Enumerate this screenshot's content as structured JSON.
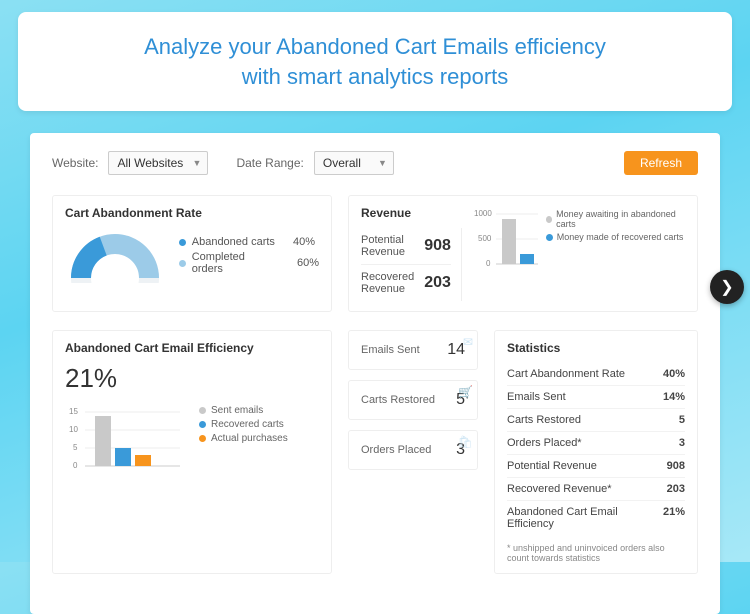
{
  "hero": {
    "title_line1": "Analyze your Abandoned Cart Emails efficiency",
    "title_line2": "with smart analytics reports"
  },
  "filters": {
    "website_label": "Website:",
    "website_value": "All Websites",
    "date_label": "Date Range:",
    "date_value": "Overall",
    "refresh_label": "Refresh"
  },
  "abandon": {
    "title": "Cart Abandonment Rate",
    "legend": [
      {
        "label": "Abandoned carts",
        "value": "40%",
        "color": "blue"
      },
      {
        "label": "Completed orders",
        "value": "60%",
        "color": "lblue"
      }
    ]
  },
  "revenue": {
    "title": "Revenue",
    "potential_label": "Potential Revenue",
    "potential_value": "908",
    "recovered_label": "Recovered Revenue",
    "recovered_value": "203",
    "legend": [
      {
        "label": "Money awaiting in abandoned carts",
        "color": "grey"
      },
      {
        "label": "Money made of recovered carts",
        "color": "blue"
      }
    ],
    "yticks": [
      "1000",
      "500",
      "0"
    ]
  },
  "efficiency": {
    "title": "Abandoned Cart Email Efficiency",
    "percent": "21%",
    "legend": [
      {
        "label": "Sent emails",
        "color": "grey"
      },
      {
        "label": "Recovered carts",
        "color": "blue"
      },
      {
        "label": "Actual purchases",
        "color": "orange"
      }
    ],
    "yticks": [
      "15",
      "10",
      "5",
      "0"
    ]
  },
  "metrics": {
    "sent_label": "Emails Sent",
    "sent_value": "14",
    "restored_label": "Carts Restored",
    "restored_value": "5",
    "orders_label": "Orders Placed",
    "orders_value": "3"
  },
  "stats": {
    "title": "Statistics",
    "rows": [
      {
        "label": "Cart Abandonment Rate",
        "value": "40%"
      },
      {
        "label": "Emails Sent",
        "value": "14%"
      },
      {
        "label": "Carts Restored",
        "value": "5"
      },
      {
        "label": "Orders Placed*",
        "value": "3"
      },
      {
        "label": "Potential Revenue",
        "value": "908"
      },
      {
        "label": "Recovered Revenue*",
        "value": "203"
      },
      {
        "label": "Abandoned Cart Email Efficiency",
        "value": "21%"
      }
    ],
    "footnote": "* unshipped and uninvoiced orders also count towards statistics"
  },
  "chart_data": [
    {
      "type": "pie",
      "title": "Cart Abandonment Rate",
      "series": [
        {
          "name": "Abandoned carts",
          "value": 40
        },
        {
          "name": "Completed orders",
          "value": 60
        }
      ]
    },
    {
      "type": "bar",
      "title": "Revenue",
      "categories": [
        "Awaiting",
        "Recovered"
      ],
      "values": [
        908,
        203
      ],
      "ylim": [
        0,
        1000
      ]
    },
    {
      "type": "bar",
      "title": "Abandoned Cart Email Efficiency",
      "categories": [
        ""
      ],
      "series": [
        {
          "name": "Sent emails",
          "values": [
            14
          ]
        },
        {
          "name": "Recovered carts",
          "values": [
            5
          ]
        },
        {
          "name": "Actual purchases",
          "values": [
            3
          ]
        }
      ],
      "ylim": [
        0,
        15
      ]
    }
  ]
}
